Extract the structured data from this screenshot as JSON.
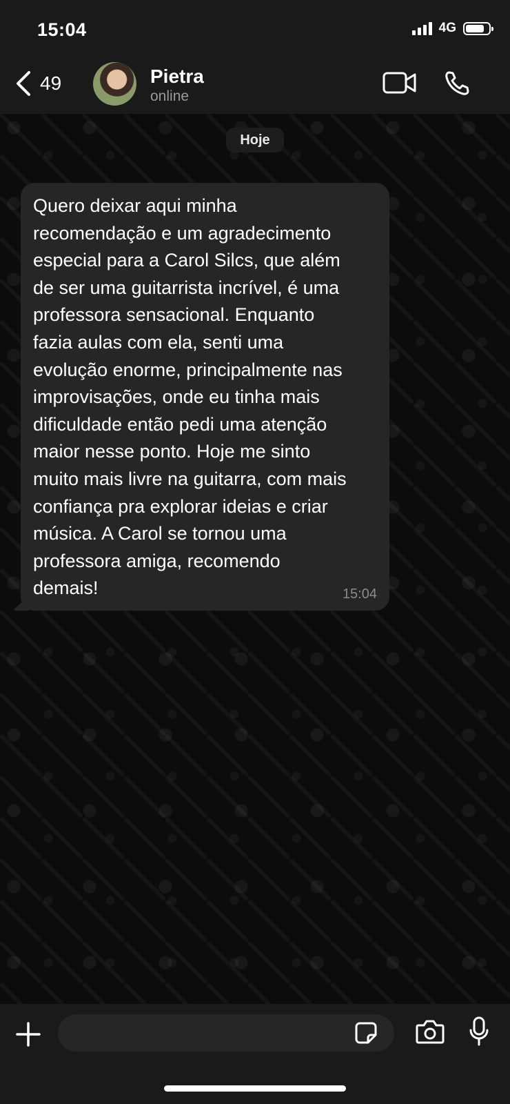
{
  "status": {
    "time": "15:04",
    "network": "4G",
    "battery_level": 0.8
  },
  "header": {
    "back_count": "49",
    "contact_name": "Pietra",
    "contact_status": "online"
  },
  "chat": {
    "date_label": "Hoje",
    "message": {
      "text": "Quero deixar aqui minha\nrecomendação e um agradecimento\nespecial para a Carol Silcs, que além\nde ser uma guitarrista incrível, é uma\nprofessora sensacional. Enquanto\nfazia aulas com ela, senti uma\nevolução enorme, principalmente nas\nimprovisações, onde eu tinha mais\ndificuldade então pedi uma atenção\nmaior nesse ponto. Hoje me sinto\nmuito mais livre na guitarra, com mais\nconfiança pra explorar ideias e criar\nmúsica. A Carol se tornou uma\nprofessora amiga, recomendo\ndemais!",
      "time": "15:04"
    }
  },
  "composer": {
    "value": ""
  },
  "icons": {
    "back": "chevron-left-icon",
    "video": "video-camera-icon",
    "call": "phone-icon",
    "attach": "plus-icon",
    "sticker": "sticker-icon",
    "camera": "camera-icon",
    "mic": "microphone-icon"
  },
  "colors": {
    "background": "#0b0b0b",
    "bar": "#1a1a1a",
    "bubble": "#262626",
    "muted": "#9a9a9a"
  }
}
